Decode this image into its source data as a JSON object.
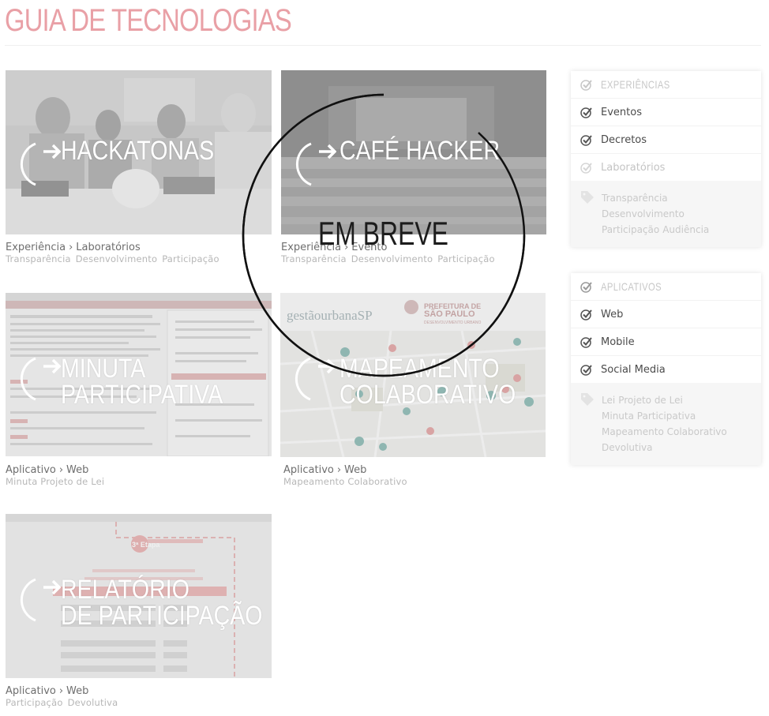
{
  "page": {
    "title": "GUIA DE TECNOLOGIAS"
  },
  "cards": [
    {
      "label_line1": "HACKATONAS",
      "label_line2": "",
      "category": "Experiência",
      "subcategory": "Laboratórios",
      "tags": [
        "Transparência",
        "Desenvolvimento",
        "Participação"
      ]
    },
    {
      "label_line1": "CAFÉ HACKER",
      "label_line2": "",
      "category": "Experiência",
      "subcategory": "Evento",
      "tags": [
        "Transparência",
        "Desenvolvimento",
        "Participação"
      ]
    },
    {
      "label_line1": "MINUTA",
      "label_line2": "PARTICIPATIVA",
      "category": "Aplicativo",
      "subcategory": "Web",
      "tags": [
        "Minuta Projeto de Lei"
      ]
    },
    {
      "label_line1": "MAPEAMENTO",
      "label_line2": "COLABORATIVO",
      "category": "Aplicativo",
      "subcategory": "Web",
      "tags": [
        "Mapeamento Colaborativo"
      ]
    },
    {
      "label_line1": "RELATÓRIO",
      "label_line2": "DE PARTICIPAÇÃO",
      "category": "Aplicativo",
      "subcategory": "Web",
      "tags": [
        "Participação",
        "Devolutiva"
      ]
    }
  ],
  "map_card": {
    "brand": "gestãourbanaSP",
    "prefeitura": "PREFEITURA DE",
    "city": "SÃO PAULO",
    "dept": "DESENVOLVIMENTO URBANO"
  },
  "report_card": {
    "stage": "3ª Etapa"
  },
  "overlay": {
    "text": "EM BREVE"
  },
  "sidebar": {
    "experiencias": {
      "header": "EXPERIÊNCIAS",
      "items": [
        {
          "label": "Eventos",
          "checked": true
        },
        {
          "label": "Decretos",
          "checked": true
        },
        {
          "label": "Laboratórios",
          "checked": false
        }
      ],
      "tags_line1": [
        "Transparência"
      ],
      "tags_line2": [
        "Desenvolvimento"
      ],
      "tags_line3": [
        "Participação",
        "Audiência"
      ]
    },
    "aplicativos": {
      "header": "APLICATIVOS",
      "items": [
        {
          "label": "Web",
          "checked": true
        },
        {
          "label": "Mobile",
          "checked": true
        },
        {
          "label": "Social Media",
          "checked": true
        }
      ],
      "tags_line1": [
        "Lei",
        "Projeto de Lei"
      ],
      "tags_line2": [
        "Minuta Participativa"
      ],
      "tags_line3": [
        "Mapeamento Colaborativo"
      ],
      "tags_line4": [
        "Devolutiva"
      ]
    }
  },
  "colors": {
    "title": "#e9a0a6",
    "accent_check": "#555555"
  }
}
